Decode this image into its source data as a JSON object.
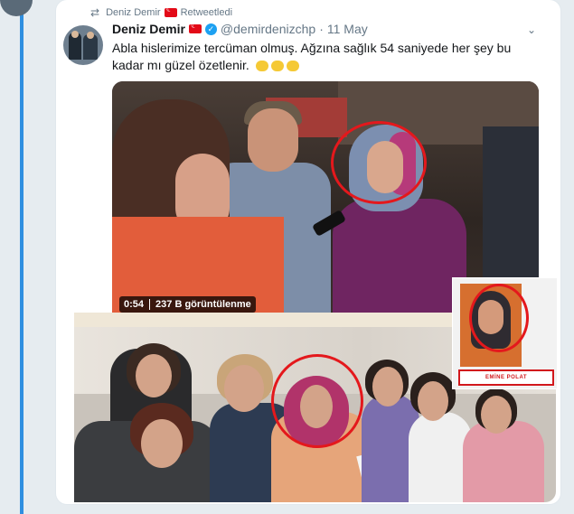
{
  "retweet_header": {
    "text_before": "Deniz Demir",
    "text_after": "Retweetledi"
  },
  "tweet": {
    "author_name": "Deniz Demir",
    "handle": "@demirdenizchp",
    "separator": "·",
    "date": "11 May",
    "text": "Abla hislerimize tercüman olmuş. Ağzına sağlık 54 saniyede her şey bu kadar mı güzel özetlenir."
  },
  "video": {
    "duration": "0:54",
    "views": "237 B görüntülenme"
  },
  "inset": {
    "name_label": "EMİNE POLAT"
  },
  "icons": {
    "retweet": "retweet-icon",
    "flag": "turkey-flag-icon",
    "verified": "verified-badge-icon",
    "menu": "chevron-down-icon",
    "emoji": "clapping-hands-emoji-icon"
  },
  "colors": {
    "accent_rail": "#2f8fe0",
    "verified": "#1da1f2",
    "highlight_circle": "#e4181c",
    "secondary_text": "#657786"
  }
}
